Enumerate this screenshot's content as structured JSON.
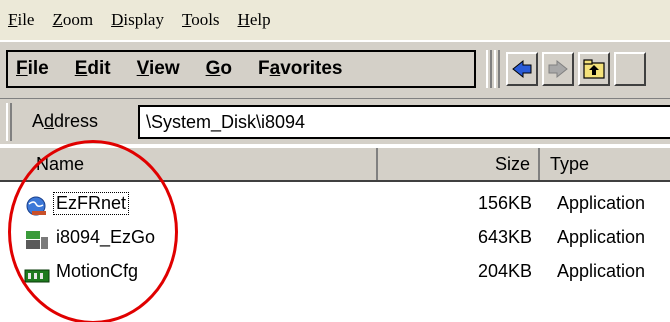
{
  "zoom_menu": [
    {
      "first": "F",
      "rest": "ile"
    },
    {
      "first": "Z",
      "rest": "oom"
    },
    {
      "first": "D",
      "rest": "isplay"
    },
    {
      "first": "T",
      "rest": "ools"
    },
    {
      "first": "H",
      "rest": "elp"
    }
  ],
  "command_menu": [
    {
      "before": "",
      "u": "F",
      "after": "ile"
    },
    {
      "before": "",
      "u": "E",
      "after": "dit"
    },
    {
      "before": "",
      "u": "V",
      "after": "iew"
    },
    {
      "before": "",
      "u": "G",
      "after": "o"
    },
    {
      "before": "F",
      "u": "a",
      "after": "vorites"
    }
  ],
  "toolbar": {
    "back_icon": "back-arrow-icon",
    "forward_icon": "forward-arrow-icon",
    "up_icon": "up-folder-icon"
  },
  "address": {
    "label_before": "A",
    "label_u": "d",
    "label_after": "dress",
    "value": "\\System_Disk\\i8094"
  },
  "columns": {
    "name": "Name",
    "size": "Size",
    "type": "Type"
  },
  "files": [
    {
      "name": "EzFRnet",
      "size": "156KB",
      "type": "Application",
      "icon": "globe-app-icon",
      "focused": true
    },
    {
      "name": "i8094_EzGo",
      "size": "643KB",
      "type": "Application",
      "icon": "pac-ezgo-icon",
      "focused": false
    },
    {
      "name": "MotionCfg",
      "size": "204KB",
      "type": "Application",
      "icon": "green-board-icon",
      "focused": false
    }
  ],
  "colors": {
    "annotation_circle": "#e00000",
    "chrome": "#d4d0c8"
  }
}
